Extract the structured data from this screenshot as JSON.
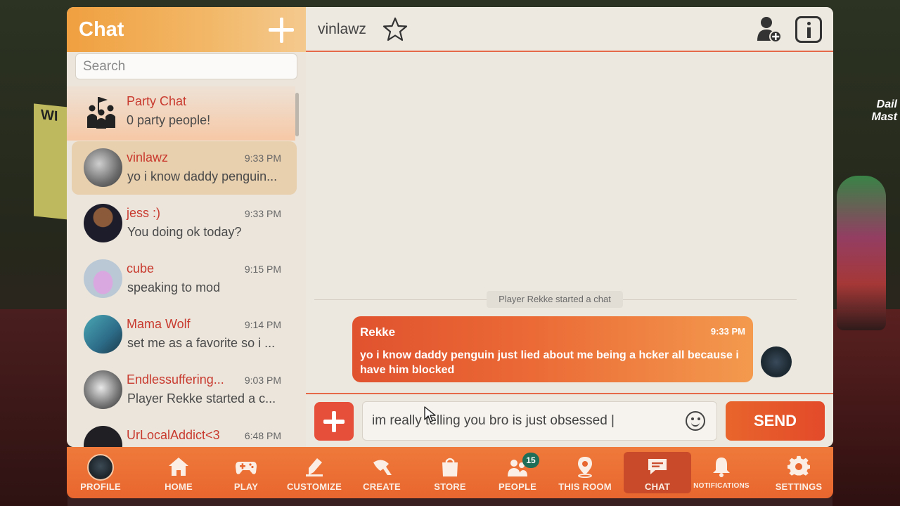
{
  "sidebar": {
    "title": "Chat",
    "search_placeholder": "Search",
    "party": {
      "name": "Party Chat",
      "subtitle": "0 party people!"
    },
    "conversations": [
      {
        "name": "vinlawz",
        "time": "9:33 PM",
        "preview": "yo i know daddy penguin...",
        "active": true
      },
      {
        "name": "jess :)",
        "time": "9:33 PM",
        "preview": "You doing ok today?"
      },
      {
        "name": "cube",
        "time": "9:15 PM",
        "preview": "speaking to mod"
      },
      {
        "name": "Mama Wolf",
        "time": "9:14 PM",
        "preview": "set me as a favorite so i ..."
      },
      {
        "name": "Endlessuffering...",
        "time": "9:03 PM",
        "preview": "Player Rekke started a c..."
      },
      {
        "name": "UrLocalAddict<3",
        "time": "6:48 PM",
        "preview": ""
      }
    ]
  },
  "chat": {
    "title": "vinlawz",
    "system_message": "Player Rekke started a chat",
    "messages": [
      {
        "sender": "Rekke",
        "time": "9:33 PM",
        "text": "yo i know daddy penguin just lied about me being a hcker all because i have him blocked"
      }
    ],
    "composer_value": "im really telling you bro is just obsessed |",
    "send_label": "SEND"
  },
  "nav": {
    "profile": "PROFILE",
    "home": "HOME",
    "play": "PLAY",
    "customize": "CUSTOMIZE",
    "create": "CREATE",
    "store": "STORE",
    "people": "PEOPLE",
    "people_badge": "15",
    "this_room": "THIS ROOM",
    "chat": "CHAT",
    "notifications": "NOTIFICATIONS",
    "settings": "SETTINGS"
  },
  "colors": {
    "accent": "#e8662f",
    "name_red": "#c93a2e",
    "bubble_start": "#e0522e",
    "bubble_end": "#f39a4e"
  },
  "icons": [
    "plus-icon",
    "star-icon",
    "add-friend-icon",
    "info-icon",
    "emoji-icon",
    "home-icon",
    "gamepad-icon",
    "customize-icon",
    "create-icon",
    "store-icon",
    "people-icon",
    "map-pin-icon",
    "chat-icon",
    "bell-icon",
    "gear-icon"
  ]
}
